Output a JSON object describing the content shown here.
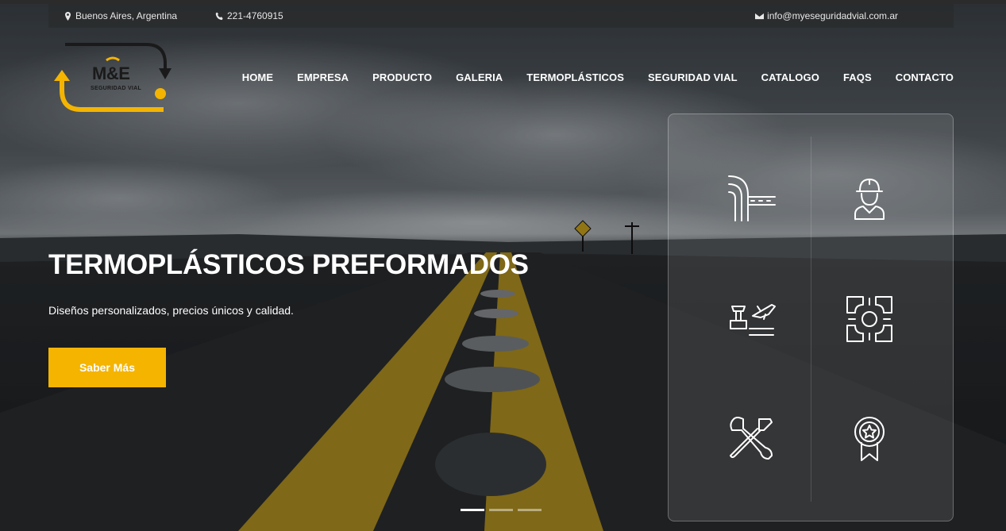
{
  "topbar": {
    "location": "Buenos Aires, Argentina",
    "phone": "221-4760915",
    "email": "info@myeseguridadvial.com.ar"
  },
  "logo": {
    "brand": "M&E",
    "tagline": "SEGURIDAD VIAL"
  },
  "nav": {
    "items": [
      {
        "label": "HOME"
      },
      {
        "label": "EMPRESA"
      },
      {
        "label": "PRODUCTO"
      },
      {
        "label": "GALERIA"
      },
      {
        "label": "TERMOPLÁSTICOS"
      },
      {
        "label": "SEGURIDAD VIAL"
      },
      {
        "label": "CATALOGO"
      },
      {
        "label": "FAQS"
      },
      {
        "label": "CONTACTO"
      }
    ]
  },
  "hero": {
    "title": "TERMOPLÁSTICOS PREFORMADOS",
    "subtitle": "Diseños personalizados, precios únicos y calidad.",
    "cta_label": "Saber Más"
  },
  "services": {
    "icons": [
      "road-intersection-icon",
      "worker-icon",
      "airport-icon",
      "road-grid-icon",
      "tools-icon",
      "award-badge-icon"
    ]
  },
  "slider": {
    "slides": 3,
    "active": 1
  },
  "colors": {
    "accent": "#f4b400",
    "text": "#ffffff",
    "topbar_bg": "#282828"
  }
}
